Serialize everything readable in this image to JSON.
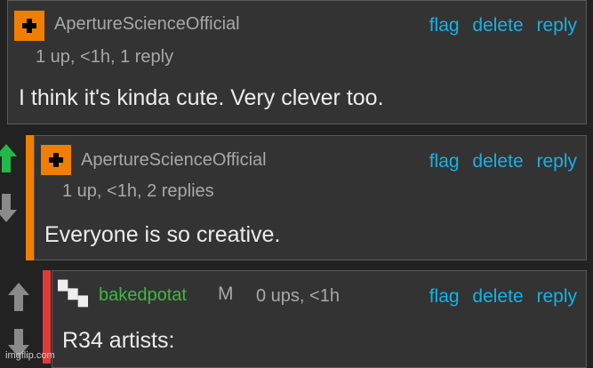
{
  "comments": [
    {
      "username": "ApertureScienceOfficial",
      "meta": "1 up, <1h, 1 reply",
      "body": "I think it's kinda cute. Very clever too.",
      "actions": [
        "flag",
        "delete",
        "reply"
      ]
    },
    {
      "username": "ApertureScienceOfficial",
      "meta": "1 up, <1h, 2 replies",
      "body": "Everyone is so creative.",
      "actions": [
        "flag",
        "delete",
        "reply"
      ]
    },
    {
      "username": "bakedpotat",
      "mod_badge": "M",
      "meta": "0 ups, <1h",
      "body": "R34 artists:",
      "actions": [
        "flag",
        "delete",
        "reply"
      ]
    }
  ],
  "watermark": "imgflip.com",
  "colors": {
    "link": "#13b3e6",
    "username_green": "#3fb83f",
    "thread_orange": "#f07f00",
    "thread_red": "#e23a3a",
    "upvote_green": "#22b84a",
    "avatar_orange": "#f07f00"
  }
}
